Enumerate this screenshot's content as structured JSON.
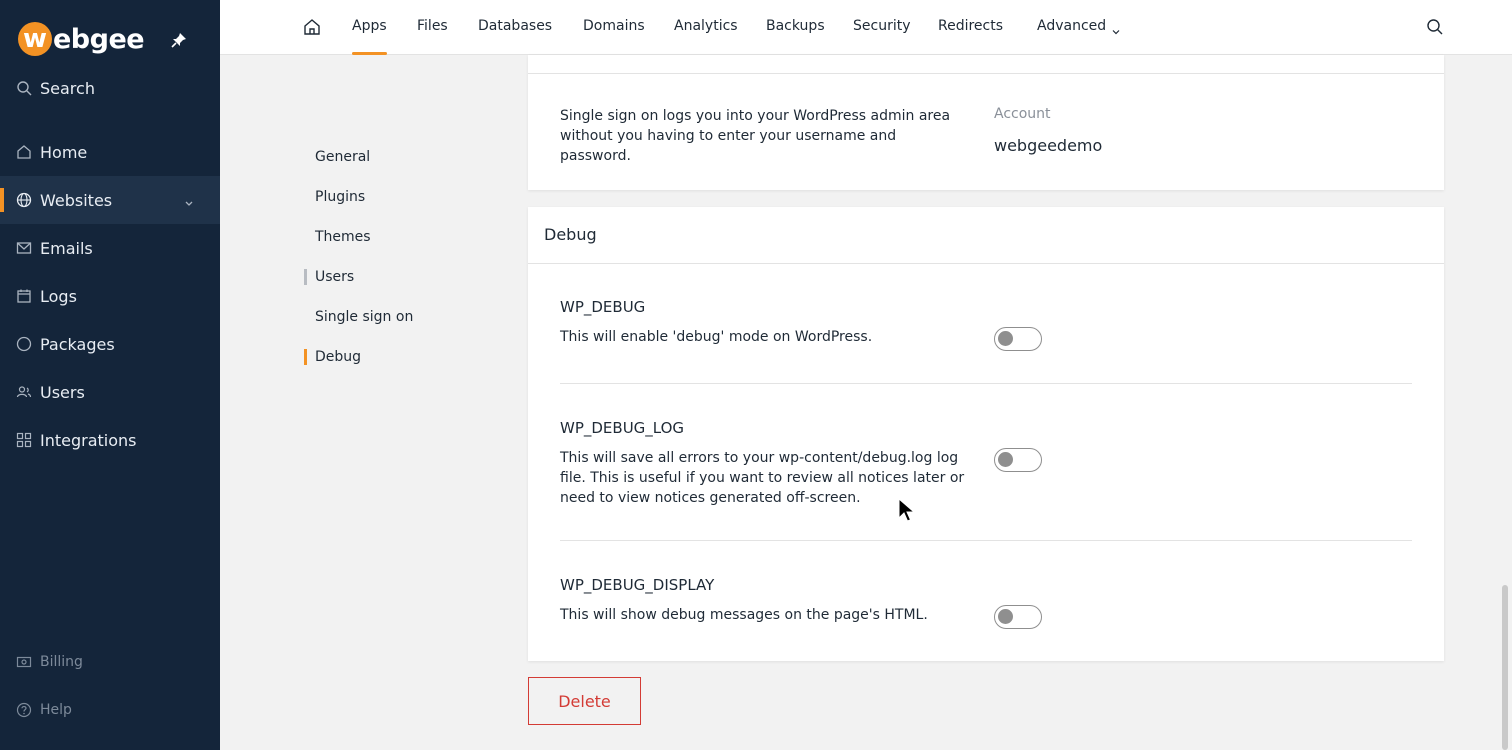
{
  "brand": {
    "logo_mark": "w",
    "logo_text": "ebgee",
    "accent": "#f39224"
  },
  "sidebar": {
    "search_label": "Search",
    "items": [
      {
        "label": "Home",
        "icon": "home-icon"
      },
      {
        "label": "Websites",
        "icon": "globe-icon",
        "active": true
      },
      {
        "label": "Emails",
        "icon": "mail-icon"
      },
      {
        "label": "Logs",
        "icon": "calendar-icon"
      },
      {
        "label": "Packages",
        "icon": "circle-icon"
      },
      {
        "label": "Users",
        "icon": "users-icon"
      },
      {
        "label": "Integrations",
        "icon": "grid-icon"
      }
    ],
    "footer": [
      {
        "label": "Billing",
        "icon": "billing-icon"
      },
      {
        "label": "Help",
        "icon": "help-icon"
      }
    ]
  },
  "topnav": {
    "items": [
      "Apps",
      "Files",
      "Databases",
      "Domains",
      "Analytics",
      "Backups",
      "Security",
      "Redirects",
      "Advanced"
    ],
    "active": "Apps"
  },
  "subnav": {
    "items": [
      "General",
      "Plugins",
      "Themes",
      "Users",
      "Single sign on",
      "Debug"
    ],
    "active": "Debug"
  },
  "sso": {
    "description": "Single sign on logs you into your WordPress admin area without you having to enter your username and password.",
    "account_label": "Account",
    "account_value": "webgeedemo"
  },
  "debug": {
    "title": "Debug",
    "options": [
      {
        "name": "WP_DEBUG",
        "description": "This will enable 'debug' mode on WordPress.",
        "enabled": false
      },
      {
        "name": "WP_DEBUG_LOG",
        "description": "This will save all errors to your wp-content/debug.log log file. This is useful if you want to review all notices later or need to view notices generated off-screen.",
        "enabled": false
      },
      {
        "name": "WP_DEBUG_DISPLAY",
        "description": "This will show debug messages on the page's HTML.",
        "enabled": false
      }
    ]
  },
  "actions": {
    "delete_label": "Delete"
  }
}
